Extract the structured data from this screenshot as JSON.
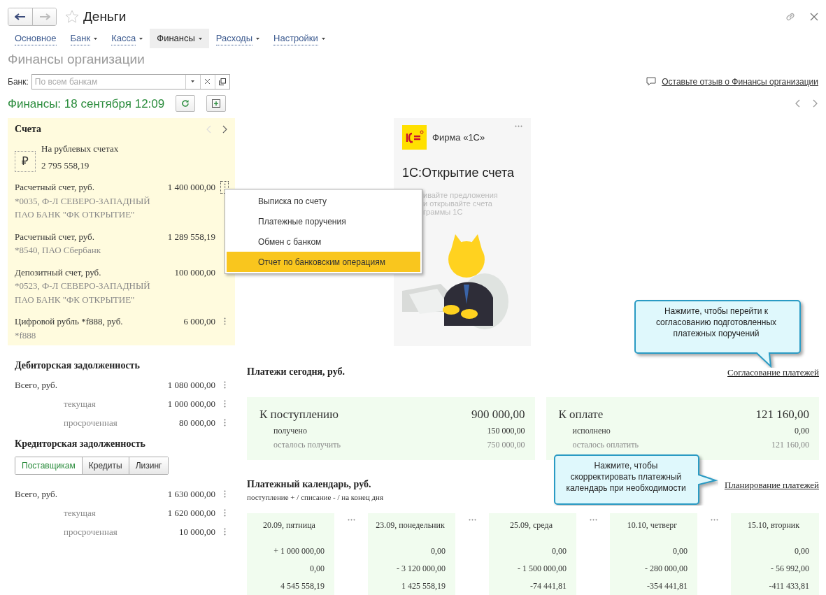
{
  "window": {
    "title": "Деньги"
  },
  "nav_tabs": [
    {
      "label": "Основное",
      "dropdown": false,
      "selected": false
    },
    {
      "label": "Банк",
      "dropdown": true,
      "selected": false
    },
    {
      "label": "Касса",
      "dropdown": true,
      "selected": false
    },
    {
      "label": "Финансы",
      "dropdown": true,
      "selected": true
    },
    {
      "label": "Расходы",
      "dropdown": true,
      "selected": false
    },
    {
      "label": "Настройки",
      "dropdown": true,
      "selected": false
    }
  ],
  "page_title": "Финансы организации",
  "bank_filter": {
    "label": "Банк:",
    "placeholder": "По всем банкам"
  },
  "feedback_link": "Оставьте отзыв о Финансы организации",
  "finance_header": "Финансы: 18 сентября 12:09",
  "accounts": {
    "title": "Счета",
    "summary": {
      "currency_symbol": "₽",
      "label": "На рублевых счетах",
      "amount": "2 795 558,19"
    },
    "items": [
      {
        "name": "Расчетный счет, руб.",
        "amount": "1 400 000,00",
        "details": [
          "*0035, Ф-Л СЕВЕРО-ЗАПАДНЫЙ",
          "ПАО БАНК \"ФК ОТКРЫТИЕ\""
        ],
        "menu_button": true,
        "focused": true
      },
      {
        "name": "Расчетный счет, руб.",
        "amount": "1 289 558,19",
        "details": [
          "*8540, ПАО Сбербанк"
        ],
        "menu_button": false,
        "focused": false
      },
      {
        "name": "Депозитный счет, руб.",
        "amount": "100 000,00",
        "details": [
          "*0523, Ф-Л СЕВЕРО-ЗАПАДНЫЙ",
          "ПАО БАНК \"ФК ОТКРЫТИЕ\""
        ],
        "menu_button": false,
        "focused": false
      },
      {
        "name": "Цифровой рубль *f888, руб.",
        "amount": "6 000,00",
        "details": [
          "*f888"
        ],
        "menu_button": true,
        "focused": false
      }
    ]
  },
  "context_menu": [
    {
      "label": "Выписка по счету",
      "selected": false
    },
    {
      "label": "Платежные поручения",
      "selected": false
    },
    {
      "label": "Обмен с банком",
      "selected": false
    },
    {
      "label": "Отчет по банковским операциям",
      "selected": true
    }
  ],
  "promo": {
    "company": "Фирма «1С»",
    "title": "1С:Открытие счета",
    "lines": [
      "ивайте предложения",
      "и открывайте счета",
      "граммы 1С"
    ]
  },
  "receivables": {
    "title": "Дебиторская задолженность",
    "rows": [
      {
        "label": "Всего, руб.",
        "amount": "1 080 000,00",
        "kind": "total"
      },
      {
        "label": "текущая",
        "amount": "1 000 000,00",
        "kind": "sub"
      },
      {
        "label": "просроченная",
        "amount": "80 000,00",
        "kind": "sub"
      }
    ]
  },
  "payables": {
    "title": "Кредиторская задолженность",
    "tabs": [
      {
        "label": "Поставщикам",
        "selected": true
      },
      {
        "label": "Кредиты",
        "selected": false
      },
      {
        "label": "Лизинг",
        "selected": false
      }
    ],
    "rows": [
      {
        "label": "Всего, руб.",
        "amount": "1 630 000,00",
        "kind": "total"
      },
      {
        "label": "текущая",
        "amount": "1 620 000,00",
        "kind": "sub"
      },
      {
        "label": "просроченная",
        "amount": "10 000,00",
        "kind": "sub"
      }
    ]
  },
  "payments_today": {
    "title": "Платежи сегодня, руб.",
    "link": "Согласование платежей",
    "cards": [
      {
        "title": "К поступлению",
        "amount": "900 000,00",
        "rows": [
          {
            "label": "получено",
            "amount": "150 000,00",
            "kind": "done"
          },
          {
            "label": "осталось получить",
            "amount": "750 000,00",
            "kind": "remaining"
          }
        ]
      },
      {
        "title": "К оплате",
        "amount": "121 160,00",
        "rows": [
          {
            "label": "исполнено",
            "amount": "0,00",
            "kind": "done"
          },
          {
            "label": "осталось оплатить",
            "amount": "121 160,00",
            "kind": "remaining"
          }
        ]
      }
    ]
  },
  "payment_calendar": {
    "title": "Платежный календарь, руб.",
    "subtitle": "поступление + / списание - / на конец дня",
    "link": "Планирование платежей",
    "days": [
      {
        "date": "20.09, пятница",
        "income": "+ 1 000 000,00",
        "expense": "0,00",
        "balance": "4 545 558,19"
      },
      {
        "date": "23.09, понедельник",
        "income": "0,00",
        "expense": "- 3 120 000,00",
        "balance": "1 425 558,19"
      },
      {
        "date": "25.09, среда",
        "income": "0,00",
        "expense": "- 1 500 000,00",
        "balance": "-74 441,81"
      },
      {
        "date": "10.10, четверг",
        "income": "0,00",
        "expense": "- 280 000,00",
        "balance": "-354 441,81"
      },
      {
        "date": "15.10, вторник",
        "income": "0,00",
        "expense": "- 56 992,00",
        "balance": "-411 433,81"
      }
    ]
  },
  "callouts": [
    {
      "text": "Нажмите, чтобы перейти к согласованию подготовленных платежных поручений"
    },
    {
      "text": "Нажмите, чтобы скорректировать платежный календарь при необходимости"
    }
  ]
}
